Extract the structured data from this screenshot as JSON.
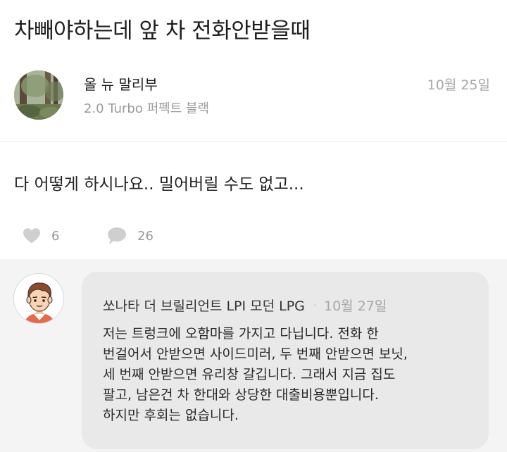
{
  "post": {
    "title": "차빼야하는데 앞 차 전화안받을때",
    "author": "올 뉴 말리부",
    "author_car": "2.0 Turbo 퍼펙트 블랙",
    "date": "10월 25일",
    "body": "다 어떻게 하시나요.. 밀어버릴 수도 없고...",
    "likes": "6",
    "comments": "26"
  },
  "comment": {
    "author": "쏘나타 더 브릴리언트 LPI 모던 LPG",
    "separator": "·",
    "date": "10월 27일",
    "lines": [
      "저는 트렁크에 오함마를 가지고 다닙니다. 전화 한",
      "번걸어서 안받으면 사이드미러, 두 번째 안받으면 보닛,",
      "세 번째 안받으면 유리창 갈깁니다. 그래서 지금 집도",
      "팔고, 남은건 차 한대와 상당한 대출비용뿐입니다.",
      "하지만 후회는 없습니다."
    ]
  },
  "icons": {
    "like": "heart-icon",
    "comment": "speech-bubble-icon"
  },
  "colors": {
    "icon_gray": "#cfcfcf",
    "comment_bg": "#f4f4f4",
    "bubble_bg": "#e9e9e9"
  }
}
